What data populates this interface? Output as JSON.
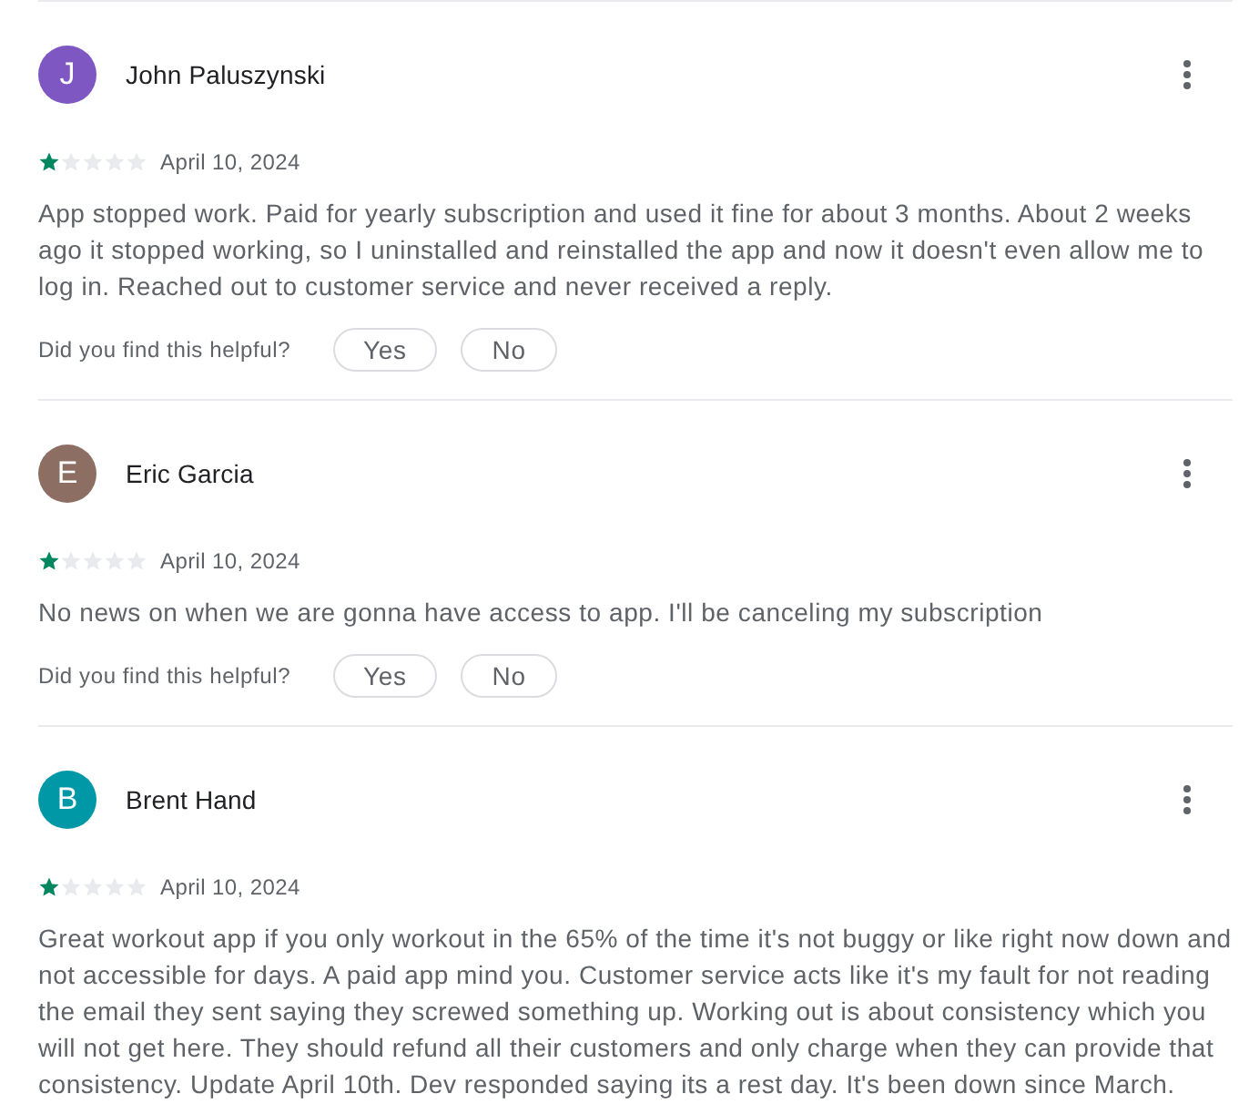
{
  "reviews": [
    {
      "author": "John Paluszynski",
      "avatar": {
        "letter": "J",
        "color": "#7e57c2"
      },
      "stars": 1,
      "date": "April 10, 2024",
      "text": "App stopped work. Paid for yearly subscription and used it fine for about 3 months. About 2 weeks ago it stopped working, so I uninstalled and reinstalled the app and now it doesn't even allow me to log in. Reached out to customer service and never received a reply.",
      "helpful": {
        "question": "Did you find this helpful?",
        "buttons": [
          "Yes",
          "No"
        ]
      }
    },
    {
      "author": "Eric Garcia",
      "avatar": {
        "letter": "E",
        "color": "#8d6e63"
      },
      "stars": 1,
      "date": "April 10, 2024",
      "text": "No news on when we are gonna have access to app. I'll be canceling my subscription",
      "helpful": {
        "question": "Did you find this helpful?",
        "buttons": [
          "Yes",
          "No"
        ]
      }
    },
    {
      "author": "Brent Hand",
      "avatar": {
        "letter": "B",
        "color": "#0097a7"
      },
      "stars": 1,
      "date": "April 10, 2024",
      "text": "Great workout app if you only workout in the 65% of the time it's not buggy or like right now down and not accessible for days. A paid app mind you. Customer service acts like it's my fault for not reading the email they sent saying they screwed something up. Working out is about consistency which you will not get here. They should refund all their customers and only charge when they can provide that consistency. Update April 10th. Dev responded saying its a rest day. It's been down since March."
    }
  ]
}
